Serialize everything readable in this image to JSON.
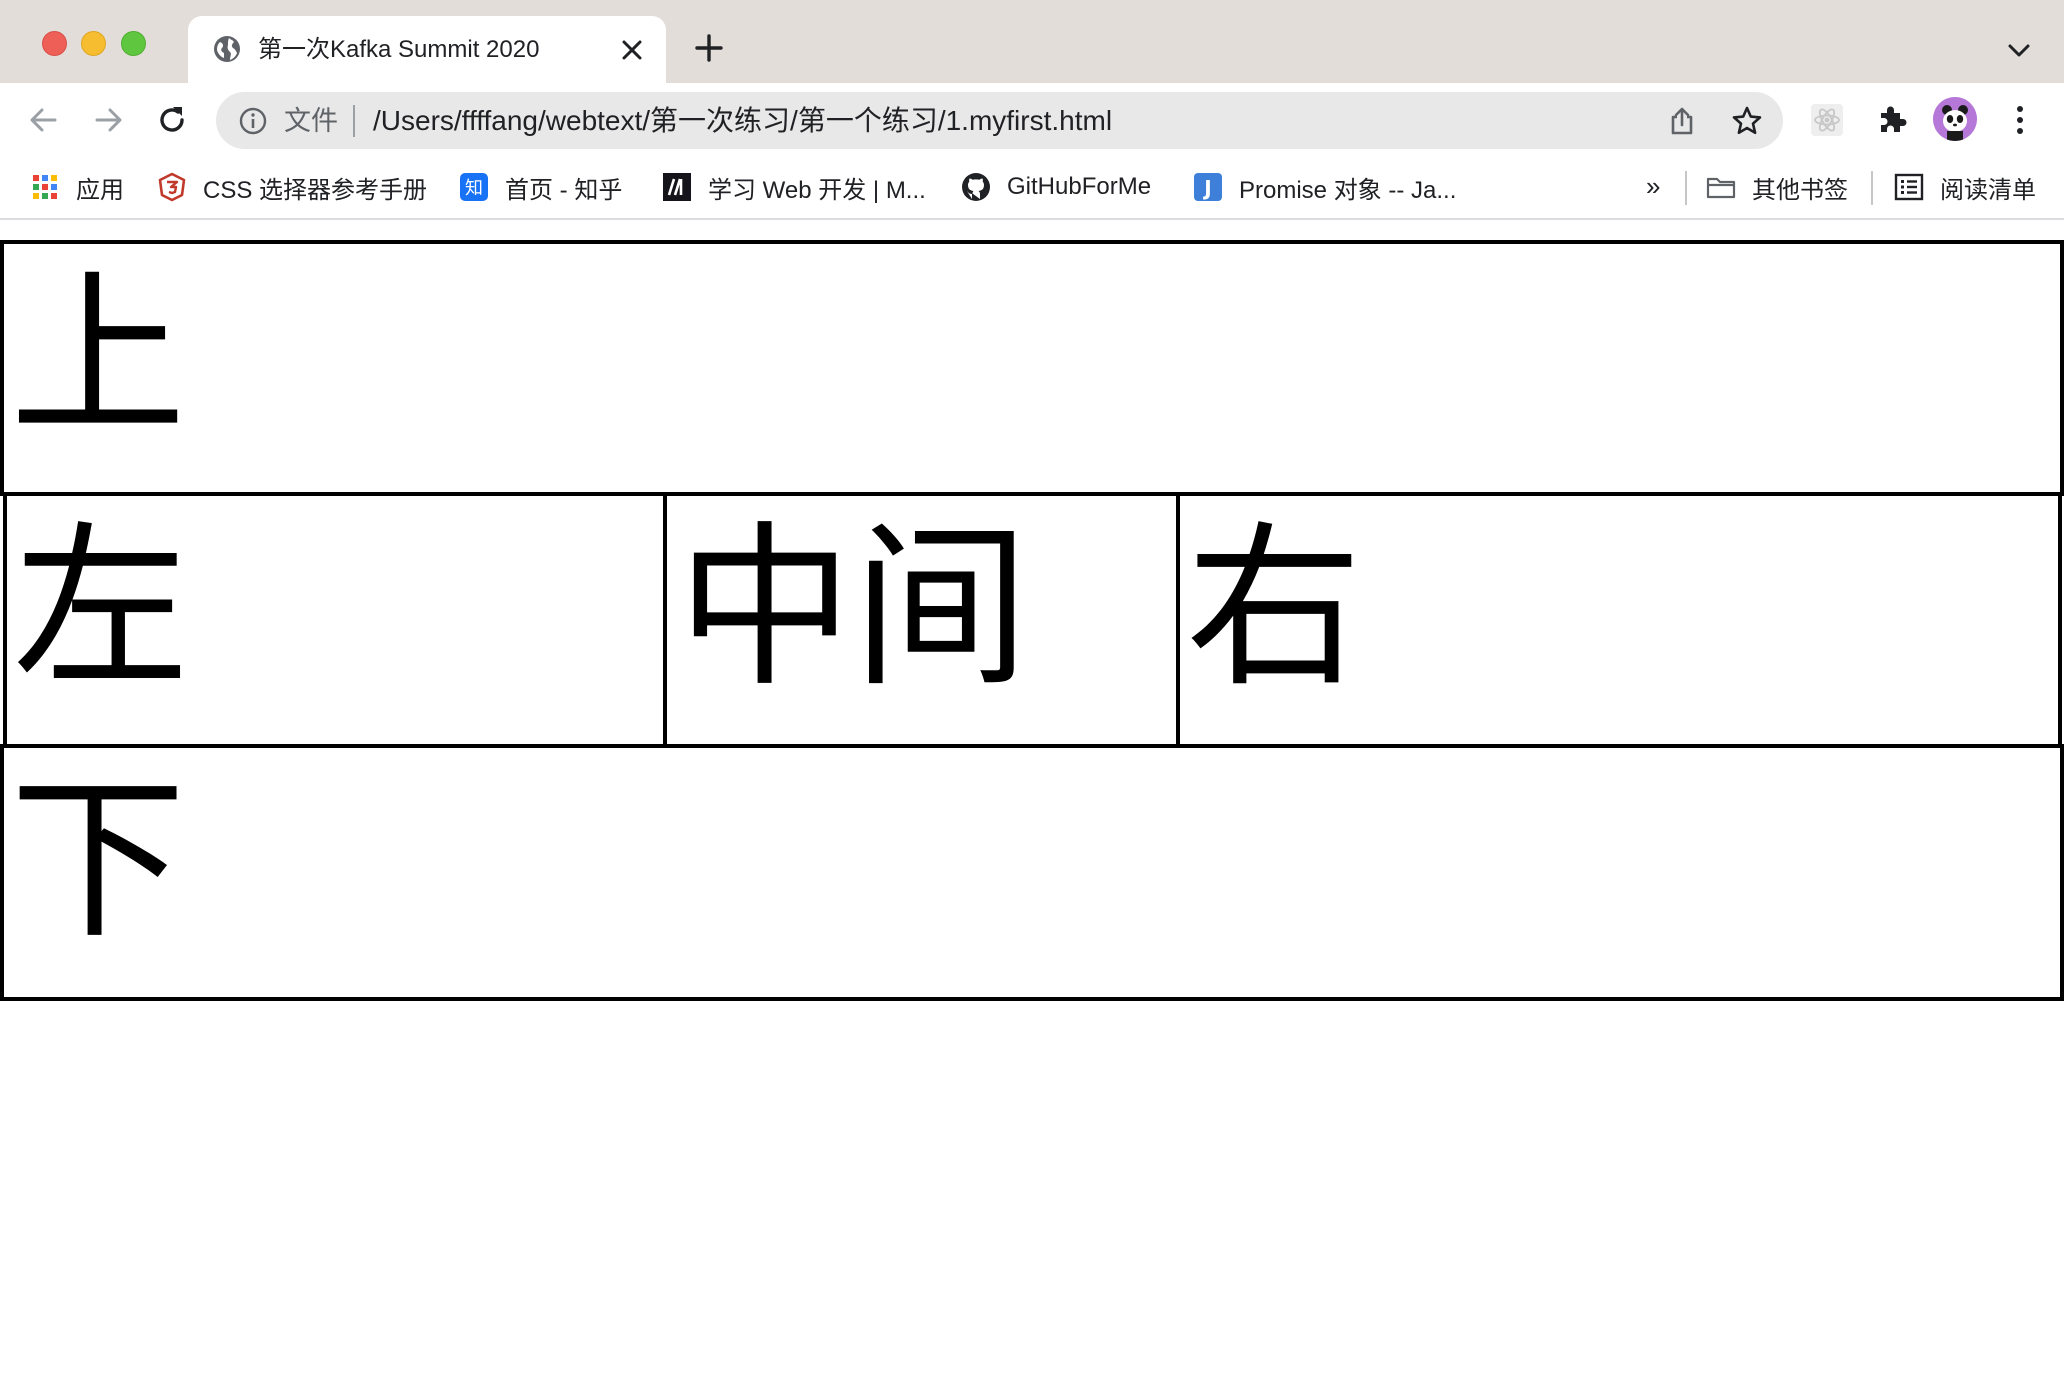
{
  "browser": {
    "tab": {
      "title": "第一次Kafka Summit 2020",
      "favicon": "globe-icon"
    },
    "toolbar": {
      "back_icon": "back-arrow-icon",
      "forward_icon": "forward-arrow-icon",
      "reload_icon": "reload-icon",
      "omnibox": {
        "scheme_label": "文件",
        "url": "/Users/ffffang/webtext/第一次练习/第一个练习/1.myfirst.html"
      }
    },
    "bookmarks": [
      {
        "label": "应用",
        "icon": "apps-grid-icon"
      },
      {
        "label": "CSS 选择器参考手册",
        "icon": "css3-shield-icon"
      },
      {
        "label": "首页 - 知乎",
        "icon": "zhihu-icon"
      },
      {
        "label": "学习 Web 开发 | M...",
        "icon": "mdn-icon"
      },
      {
        "label": "GitHubForMe",
        "icon": "github-icon"
      },
      {
        "label": "Promise 对象 -- Ja...",
        "icon": "j-icon"
      }
    ],
    "bookmarks_overflow": "»",
    "other_bookmarks": "其他书签",
    "reading_list": "阅读清单",
    "colors": {
      "tabstrip": "#e3ddd9",
      "omnibox": "#e8e8e8",
      "avatar": "#b678d8",
      "close_button": "#ee5f57",
      "minimize_button": "#f5bd2f",
      "zoom_button": "#5fc73f"
    }
  },
  "page": {
    "top": "上",
    "left": "左",
    "middle": "中间",
    "right": "右",
    "bottom": "下"
  }
}
